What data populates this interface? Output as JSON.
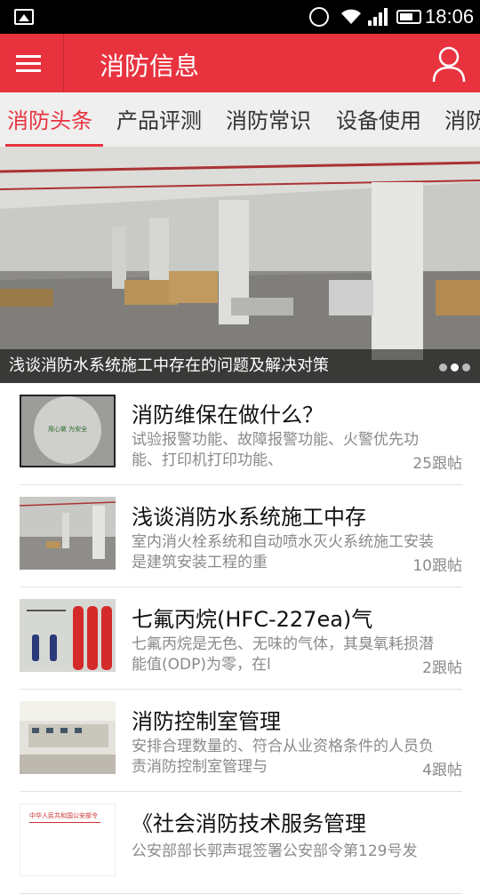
{
  "status_bar": {
    "time": "18:06"
  },
  "app_bar": {
    "title": "消防信息"
  },
  "tabs": [
    {
      "label": "消防头条",
      "active": true
    },
    {
      "label": "产品评测",
      "active": false
    },
    {
      "label": "消防常识",
      "active": false
    },
    {
      "label": "设备使用",
      "active": false
    },
    {
      "label": "消防",
      "active": false
    }
  ],
  "banner": {
    "caption": "浅谈消防水系统施工中存在的问题及解决对策",
    "slides": 3,
    "active_slide": 2
  },
  "articles": [
    {
      "title": "消防维保在做什么？",
      "summary": "试验报警功能、故障报警功能、火警优先功能、打印机打印功能、",
      "replies": "25跟帖",
      "thumb_text": "用心做 为安全"
    },
    {
      "title": "浅谈消防水系统施工中存",
      "summary": "室内消火栓系统和自动喷水灭火系统施工安装是建筑安装工程的重",
      "replies": "10跟帖"
    },
    {
      "title": "七氟丙烷(HFC-227ea)气",
      "summary": "七氟丙烷是无色、无味的气体，其臭氧耗损潜能值(ODP)为零，在l",
      "replies": "2跟帖"
    },
    {
      "title": "消防控制室管理",
      "summary": "安排合理数量的、符合从业资格条件的人员负责消防控制室管理与",
      "replies": "4跟帖"
    },
    {
      "title": "《社会消防技术服务管理",
      "summary": "公安部部长郭声琨签署公安部令第129号发",
      "replies": "",
      "thumb_text": "中华人民共和国公安部令"
    }
  ],
  "colors": {
    "brand": "#e8333f",
    "tab_bg": "#efefef",
    "muted_text": "#8a8a8a"
  }
}
